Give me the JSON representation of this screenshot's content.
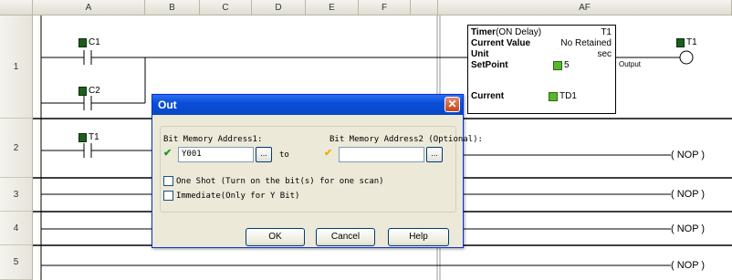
{
  "columns": {
    "A": "A",
    "B": "B",
    "C": "C",
    "D": "D",
    "E": "E",
    "F": "F",
    "AF": "AF"
  },
  "rows": [
    "1",
    "2",
    "3",
    "4",
    "5"
  ],
  "ladder": {
    "contact_c1": "C1",
    "contact_c2": "C2",
    "contact_t1_row2": "T1",
    "coil_t1": "T1",
    "output_label": "Output",
    "nop": [
      "( NOP )",
      "( NOP )",
      "( NOP )",
      "( NOP )"
    ]
  },
  "timer_box": {
    "title": "Timer",
    "mode": "(ON Delay)",
    "name": "T1",
    "current_value_label": "Current Value",
    "current_value": "No Retained",
    "unit_label": "Unit",
    "unit_value": "sec",
    "setpoint_label": "SetPoint",
    "setpoint_value": "5",
    "current_label": "Current",
    "current_addr": "TD1"
  },
  "dialog": {
    "title": "Out",
    "close": "✕",
    "addr1_label": "Bit Memory Address1:",
    "addr1_value": "Y001",
    "to_label": "to",
    "addr2_label": "Bit Memory Address2 (Optional):",
    "addr2_value": "",
    "browse": "...",
    "one_shot": "One Shot (Turn on the bit(s) for one scan)",
    "immediate": "Immediate(Only for Y Bit)",
    "ok": "OK",
    "cancel": "Cancel",
    "help": "Help"
  },
  "colors": {
    "titlebar": "#0a4fd8",
    "check_green": "#1f9a1f",
    "check_yellow": "#e8b400"
  }
}
